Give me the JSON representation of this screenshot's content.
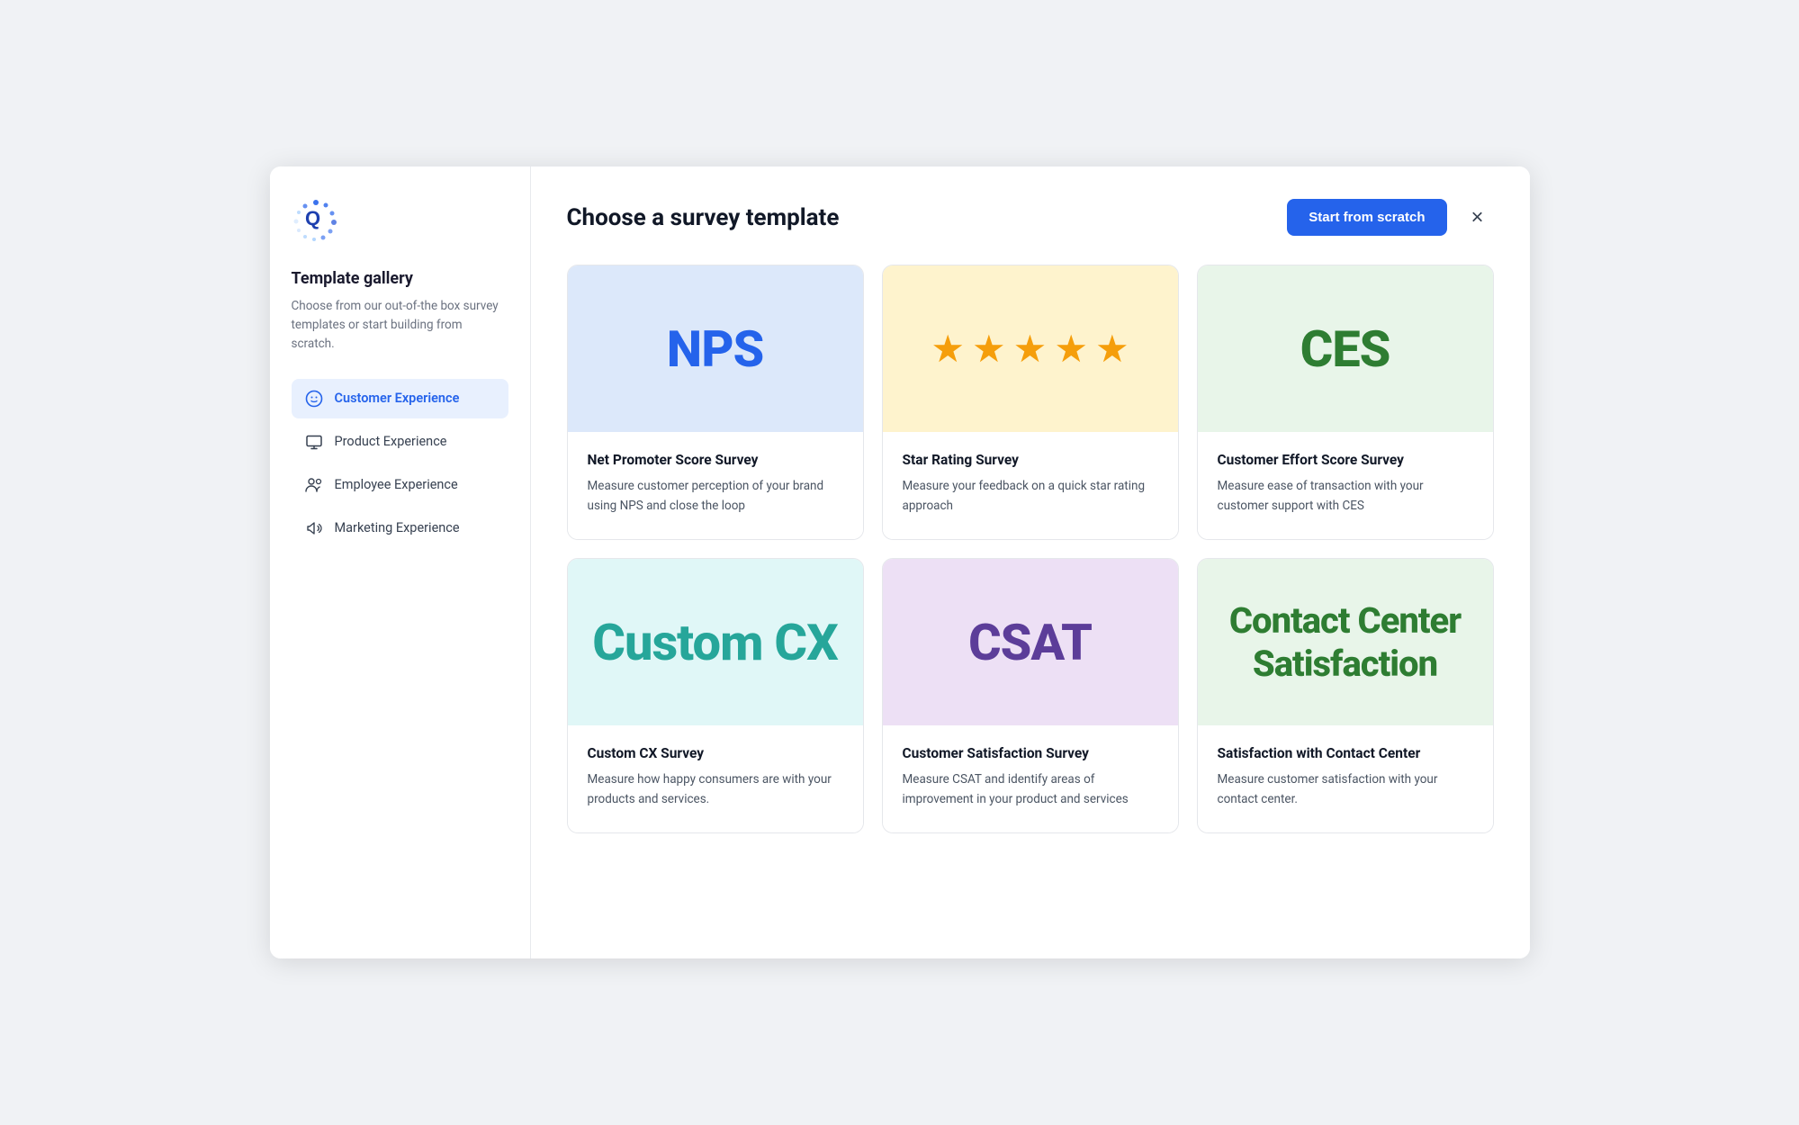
{
  "sidebar": {
    "title": "Template gallery",
    "description": "Choose from our out-of-the box survey templates or start building from scratch.",
    "nav_items": [
      {
        "id": "customer-experience",
        "label": "Customer Experience",
        "icon": "smiley",
        "active": true
      },
      {
        "id": "product-experience",
        "label": "Product Experience",
        "icon": "monitor",
        "active": false
      },
      {
        "id": "employee-experience",
        "label": "Employee Experience",
        "icon": "employees",
        "active": false
      },
      {
        "id": "marketing-experience",
        "label": "Marketing Experience",
        "icon": "megaphone",
        "active": false
      }
    ]
  },
  "header": {
    "title": "Choose a survey template",
    "start_button": "Start from scratch",
    "close_label": "×"
  },
  "templates": [
    {
      "id": "nps",
      "image_type": "text",
      "image_text": "NPS",
      "image_class": "nps-bg",
      "text_class": "nps-text",
      "name": "Net Promoter Score Survey",
      "description": "Measure customer perception of your brand using NPS and close the loop"
    },
    {
      "id": "star-rating",
      "image_type": "stars",
      "image_class": "star-bg",
      "name": "Star Rating Survey",
      "description": "Measure your feedback on a quick star rating approach"
    },
    {
      "id": "ces",
      "image_type": "text",
      "image_text": "CES",
      "image_class": "ces-bg",
      "text_class": "ces-text",
      "name": "Customer Effort Score Survey",
      "description": "Measure ease of transaction with your customer support with CES"
    },
    {
      "id": "custom-cx",
      "image_type": "text",
      "image_text": "Custom CX",
      "image_class": "cx-bg",
      "text_class": "cx-text",
      "name": "Custom CX Survey",
      "description": "Measure how happy consumers are with your products and services."
    },
    {
      "id": "csat",
      "image_type": "text",
      "image_text": "CSAT",
      "image_class": "csat-bg",
      "text_class": "csat-text",
      "name": "Customer Satisfaction Survey",
      "description": "Measure CSAT and identify areas of improvement in your product and services"
    },
    {
      "id": "contact-center",
      "image_type": "text",
      "image_text": "Contact Center Satisfaction",
      "image_class": "cc-bg",
      "text_class": "cc-text",
      "name": "Satisfaction with Contact Center",
      "description": "Measure customer satisfaction with your contact center."
    }
  ]
}
